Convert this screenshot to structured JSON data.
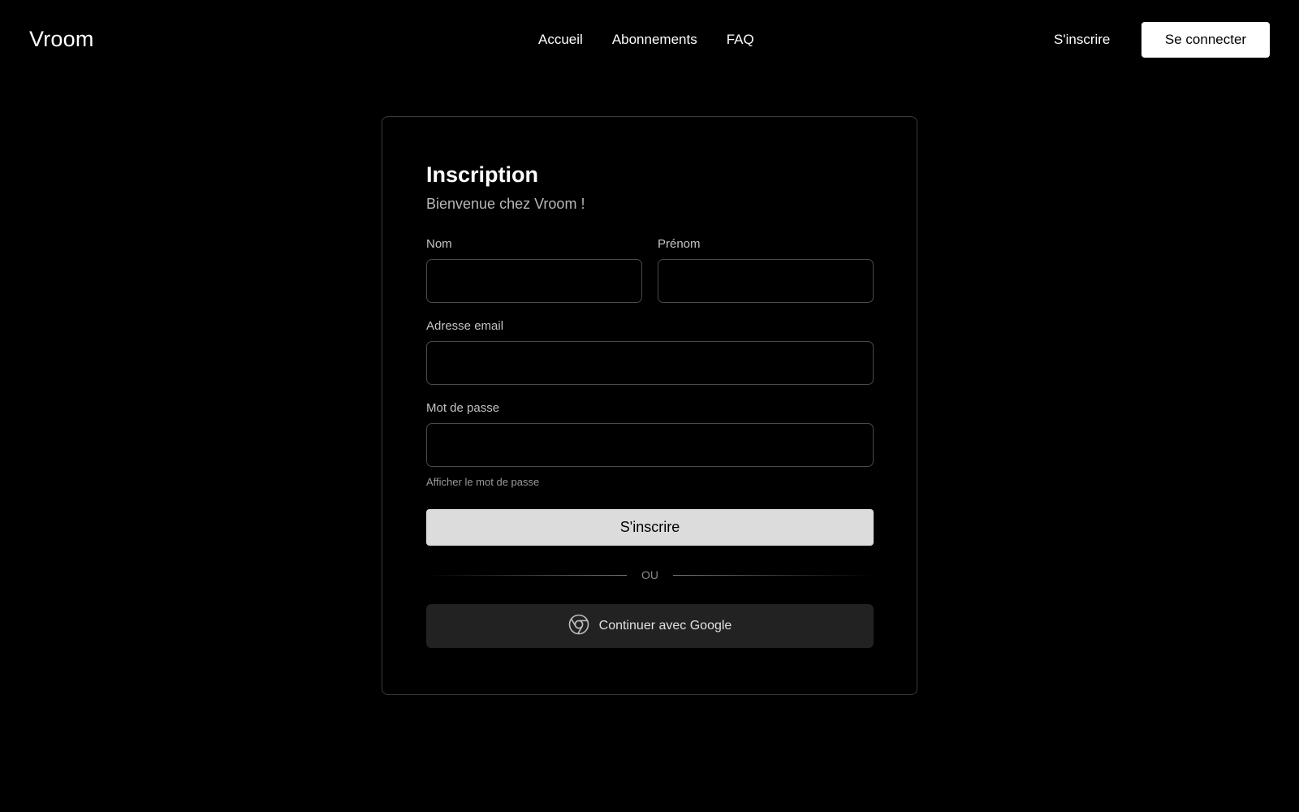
{
  "header": {
    "logo": "Vroom",
    "nav": [
      "Accueil",
      "Abonnements",
      "FAQ"
    ],
    "signup_label": "S'inscrire",
    "login_label": "Se connecter"
  },
  "form": {
    "title": "Inscription",
    "subtitle": "Bienvenue chez Vroom !",
    "fields": {
      "nom": {
        "label": "Nom",
        "value": ""
      },
      "prenom": {
        "label": "Prénom",
        "value": ""
      },
      "email": {
        "label": "Adresse email",
        "value": ""
      },
      "password": {
        "label": "Mot de passe",
        "value": ""
      }
    },
    "show_password": "Afficher le mot de passe",
    "submit_label": "S'inscrire",
    "divider_text": "OU",
    "google_label": "Continuer avec Google",
    "google_icon": "chrome-icon"
  },
  "colors": {
    "background": "#000000",
    "primary_button": "#dcdcdc",
    "secondary_button": "#222222",
    "card_border": "#3a3a3a"
  }
}
